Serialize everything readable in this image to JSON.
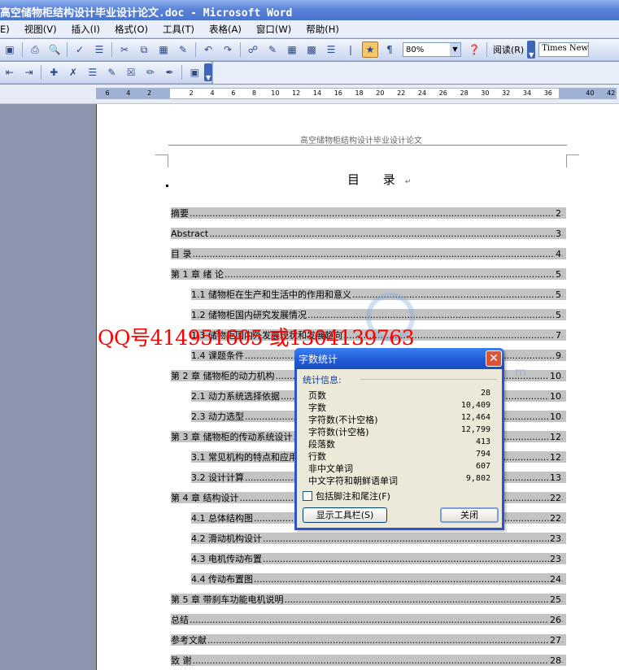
{
  "window": {
    "title": "高空储物柜结构设计毕业设计论文.doc - Microsoft Word"
  },
  "menu": [
    "E)",
    "视图(V)",
    "插入(I)",
    "格式(O)",
    "工具(T)",
    "表格(A)",
    "窗口(W)",
    "帮助(H)"
  ],
  "toolbar": {
    "zoom_value": "80%",
    "read_label": "阅读(R)",
    "font_name": "Times New"
  },
  "ruler": {
    "ticks": [
      "6",
      "4",
      "2",
      "",
      "2",
      "4",
      "6",
      "8",
      "10",
      "12",
      "14",
      "16",
      "18",
      "20",
      "22",
      "24",
      "26",
      "28",
      "30",
      "32",
      "34",
      "36",
      "",
      "40",
      "42"
    ]
  },
  "document": {
    "header": "高空储物柜结构设计毕业设计论文",
    "toc_title": "目 录",
    "toc": [
      {
        "label": "摘要",
        "page": "2",
        "level": 1
      },
      {
        "label": "Abstract",
        "page": "3",
        "level": 1
      },
      {
        "label": "目  录",
        "page": "4",
        "level": 1
      },
      {
        "label": "第 1 章  绪  论",
        "page": "5",
        "level": 1
      },
      {
        "label": "1.1 储物柜在生产和生活中的作用和意义",
        "page": "5",
        "level": 2
      },
      {
        "label": "1.2 储物柜国内研究发展情况",
        "page": "5",
        "level": 2
      },
      {
        "label": "1.3 储物柜国内外发展现状和发展趋向",
        "page": "7",
        "level": 2
      },
      {
        "label": "1.4 课题条件",
        "page": "9",
        "level": 2
      },
      {
        "label": "第 2 章  储物柜的动力机构",
        "page": "10",
        "level": 1
      },
      {
        "label": "2.1 动力系统选择依据",
        "page": "10",
        "level": 2
      },
      {
        "label": "2.3 动力选型",
        "page": "10",
        "level": 2
      },
      {
        "label": "第 3 章  储物柜的传动系统设计",
        "page": "12",
        "level": 1
      },
      {
        "label": "3.1 常见机构的特点和应用",
        "page": "12",
        "level": 2
      },
      {
        "label": "3.2 设计计算",
        "page": "13",
        "level": 2
      },
      {
        "label": "第 4 章  结构设计",
        "page": "22",
        "level": 1
      },
      {
        "label": "4.1 总体结构图",
        "page": "22",
        "level": 2
      },
      {
        "label": "4.2 滑动机构设计",
        "page": "23",
        "level": 2
      },
      {
        "label": "4.3 电机传动布置",
        "page": "23",
        "level": 2
      },
      {
        "label": "4.4 传动布置图",
        "page": "24",
        "level": 2
      },
      {
        "label": "第 5 章  带刹车功能电机说明",
        "page": "25",
        "level": 1
      },
      {
        "label": "总结",
        "page": "26",
        "level": 1
      },
      {
        "label": "参考文献",
        "page": "27",
        "level": 1
      },
      {
        "label": "致  谢",
        "page": "28",
        "level": 1
      }
    ]
  },
  "overlay": {
    "qq_text": "QQ号414951605  或1304139763"
  },
  "dialog": {
    "title": "字数统计",
    "section": "统计信息:",
    "stats": [
      {
        "label": "页数",
        "value": "28"
      },
      {
        "label": "字数",
        "value": "10,409"
      },
      {
        "label": "字符数(不计空格)",
        "value": "12,464"
      },
      {
        "label": "字符数(计空格)",
        "value": "12,799"
      },
      {
        "label": "段落数",
        "value": "413"
      },
      {
        "label": "行数",
        "value": "794"
      },
      {
        "label": "非中文单词",
        "value": "607"
      },
      {
        "label": "中文字符和朝鲜语单词",
        "value": "9,802"
      }
    ],
    "checkbox_label": "包括脚注和尾注(F)",
    "toolbar_button": "显示工具栏(S)",
    "close_button": "关闭"
  }
}
